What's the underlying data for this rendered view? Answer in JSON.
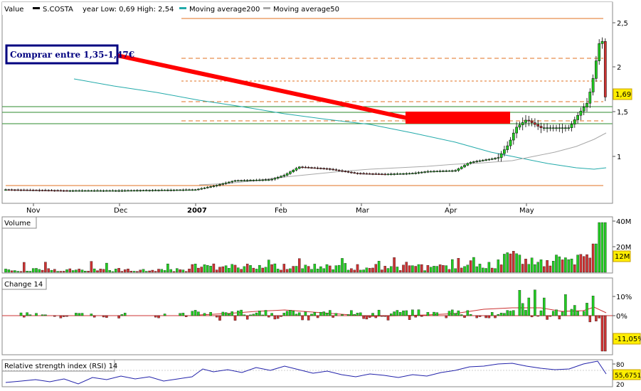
{
  "legend": {
    "value": "Value",
    "symbol": "S.COSTA",
    "range": "year Low: 0,69 High: 2,54",
    "ma200": "Moving average200",
    "ma50": "Moving average50"
  },
  "colors": {
    "up": "#22cc22",
    "down": "#cc3333",
    "ma200": "#22aaaa",
    "ma50": "#a8a8a8",
    "arrow": "#ff0000",
    "support": "#2e8b2e",
    "resistance": "#e07020",
    "label_bg": "#ffee00",
    "callout_border": "#000080"
  },
  "annotation": {
    "callout": "Comprar entre 1,35-1,47€"
  },
  "price_axis": {
    "ticks": [
      "2,5",
      "2",
      "1,5",
      "1"
    ],
    "last_label": "1,69"
  },
  "time_axis": {
    "labels": [
      "Nov",
      "Dec",
      "2007",
      "Feb",
      "Mar",
      "Apr",
      "May"
    ]
  },
  "volume_panel": {
    "title": "Volume",
    "ticks": [
      "40M",
      "20M"
    ],
    "last_label": "12M"
  },
  "change_panel": {
    "title": "Change 14",
    "ticks": [
      "10%",
      "0%"
    ],
    "last_label": "-11,05%"
  },
  "rsi_panel": {
    "title": "Relative strength index (RSI) 14",
    "ticks": [
      "80",
      "20"
    ],
    "last_label": "55,6751"
  },
  "chart_data": {
    "type": "line",
    "title": "",
    "symbol": "S.COSTA",
    "price_range_note": "year Low: 0,69 High: 2,54",
    "y_range": [
      0.55,
      2.62
    ],
    "x_period": [
      "Nov 2006",
      "May 2007"
    ],
    "support_levels": [
      1.35,
      1.47,
      1.53
    ],
    "resistance_levels": [
      0.65,
      2.54,
      2.12,
      1.87,
      1.62,
      1.38
    ],
    "price_series": [
      {
        "month": "Nov",
        "close": 0.7
      },
      {
        "month": "Dec",
        "close": 0.69
      },
      {
        "month": "Jan",
        "close": 0.7
      },
      {
        "month": "2007-Jan-end",
        "close": 0.8
      },
      {
        "month": "Feb",
        "close": 0.95
      },
      {
        "month": "Mar",
        "close": 0.85
      },
      {
        "month": "Apr",
        "close": 0.9
      },
      {
        "month": "Apr-end",
        "close": 1.05
      },
      {
        "month": "late Apr",
        "close": 1.45
      },
      {
        "month": "May",
        "close": 1.45
      },
      {
        "month": "mid May",
        "close": 1.4
      },
      {
        "month": "late May",
        "close": 2.3
      },
      {
        "month": "last",
        "close": 1.69
      }
    ],
    "ma200_series": [
      1.85,
      1.62,
      1.45,
      1.3,
      1.15,
      0.98,
      0.85
    ],
    "ma50_series": [
      0.69,
      0.7,
      0.75,
      0.8,
      0.87,
      0.93,
      1.05,
      1.28
    ],
    "volume_last": "12M",
    "change_last": "-11,05%",
    "rsi_last": "55,6751"
  }
}
